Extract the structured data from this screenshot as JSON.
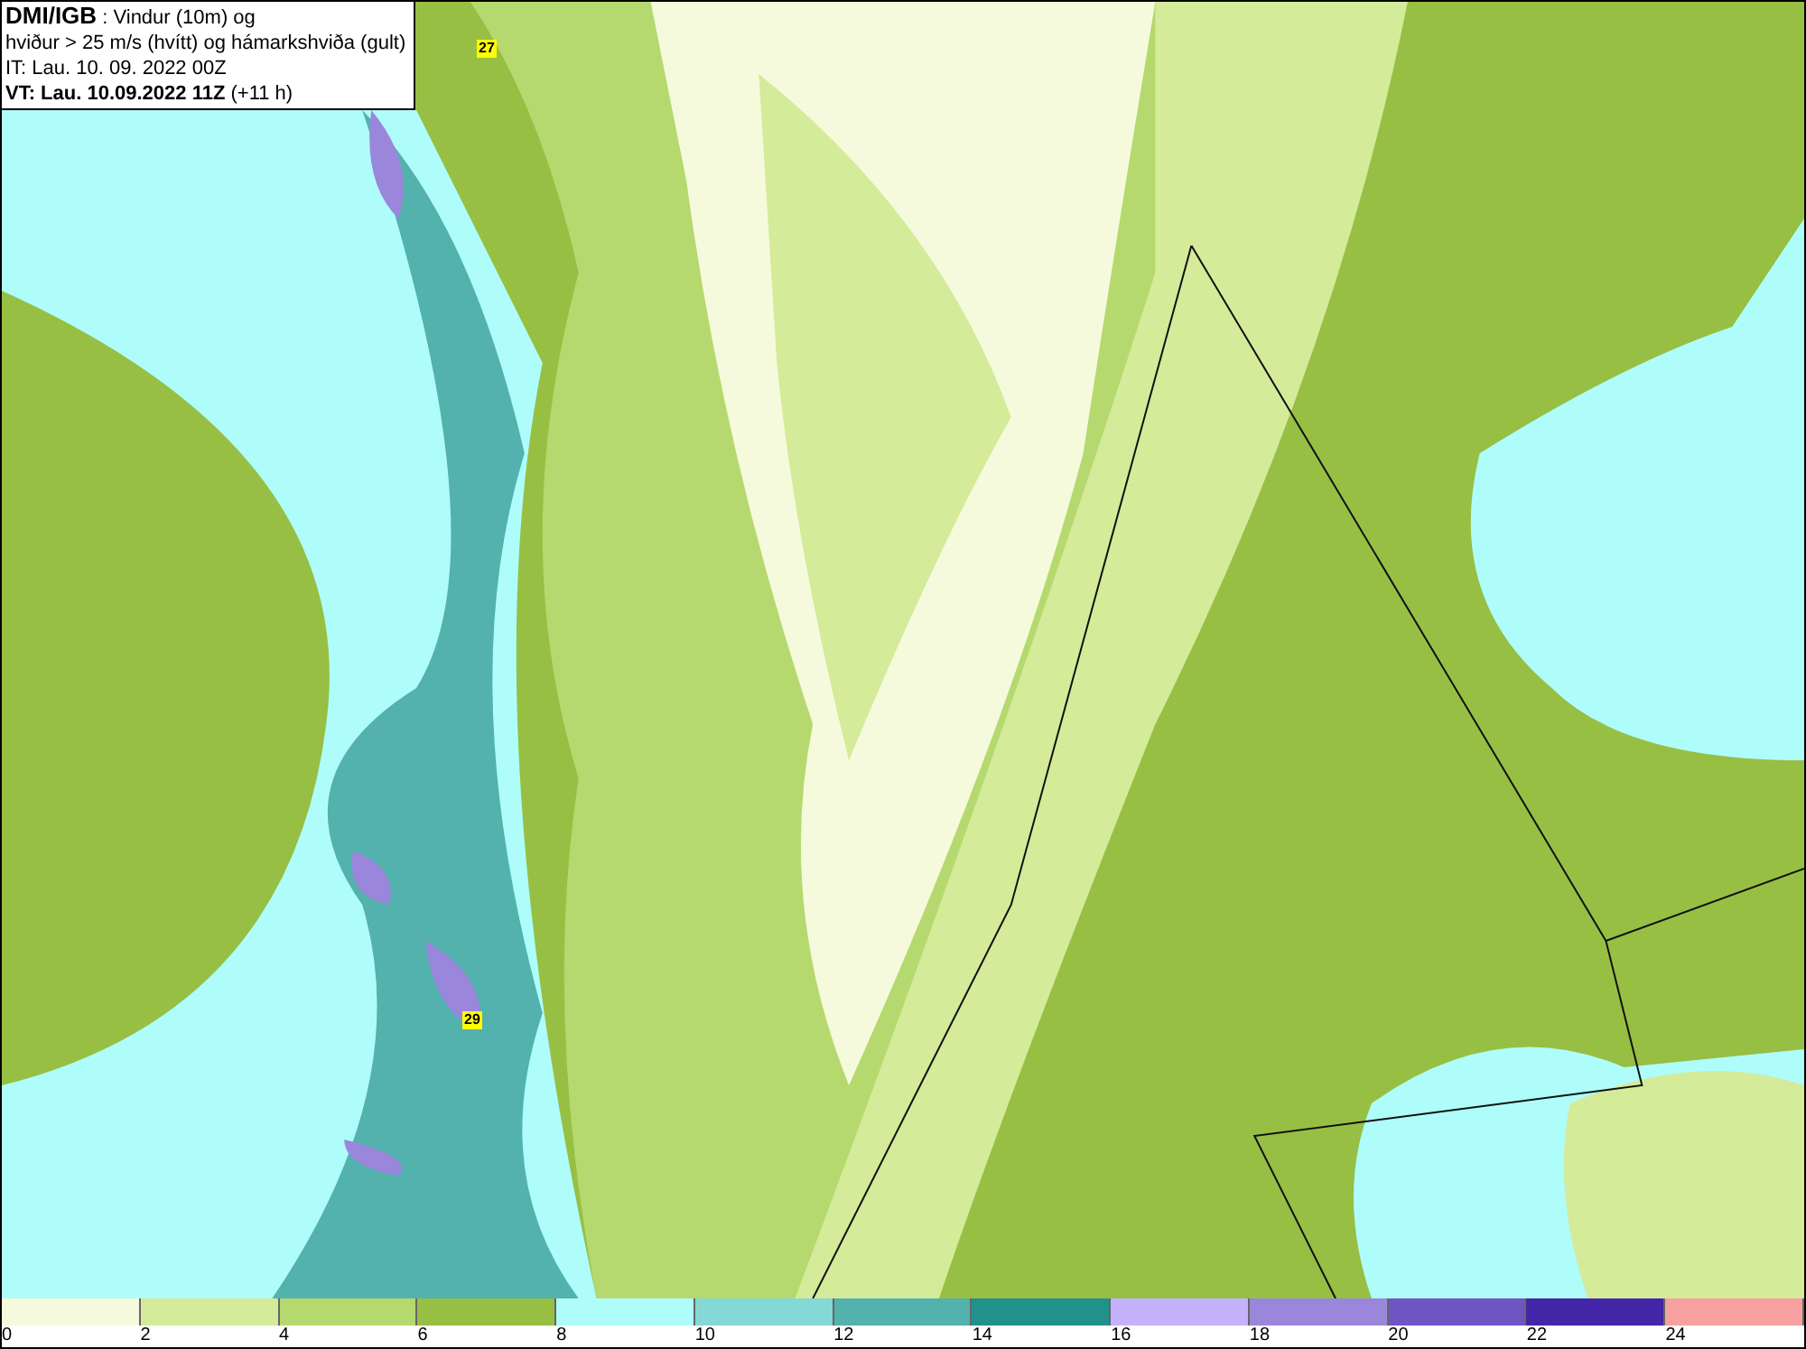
{
  "header": {
    "source": "DMI/IGB",
    "title_rest": ": Vindur (10m) og",
    "line2": "hviður > 25 m/s (hvítt) og hámarkshviða (gult)",
    "it_line": "IT: Lau. 10. 09. 2022 00Z",
    "vt_bold": "VT: Lau. 10.09.2022 11Z",
    "vt_rest": "(+11 h)"
  },
  "gust_markers": [
    {
      "label": "27",
      "kind": "max"
    },
    {
      "label": "29",
      "kind": "max"
    }
  ],
  "legend": [
    {
      "label": "0",
      "color": "#f6fadc"
    },
    {
      "label": "2",
      "color": "#d4eb9a"
    },
    {
      "label": "4",
      "color": "#b5d96e"
    },
    {
      "label": "6",
      "color": "#97bf44"
    },
    {
      "label": "8",
      "color": "#aefdfb"
    },
    {
      "label": "10",
      "color": "#84d8d6"
    },
    {
      "label": "12",
      "color": "#53b1ae"
    },
    {
      "label": "14",
      "color": "#21918c"
    },
    {
      "label": "16",
      "color": "#c4b2fc"
    },
    {
      "label": "18",
      "color": "#9a87dc"
    },
    {
      "label": "20",
      "color": "#6f55c4"
    },
    {
      "label": "22",
      "color": "#4427a8"
    },
    {
      "label": "24",
      "color": "#f8a0a0"
    }
  ]
}
